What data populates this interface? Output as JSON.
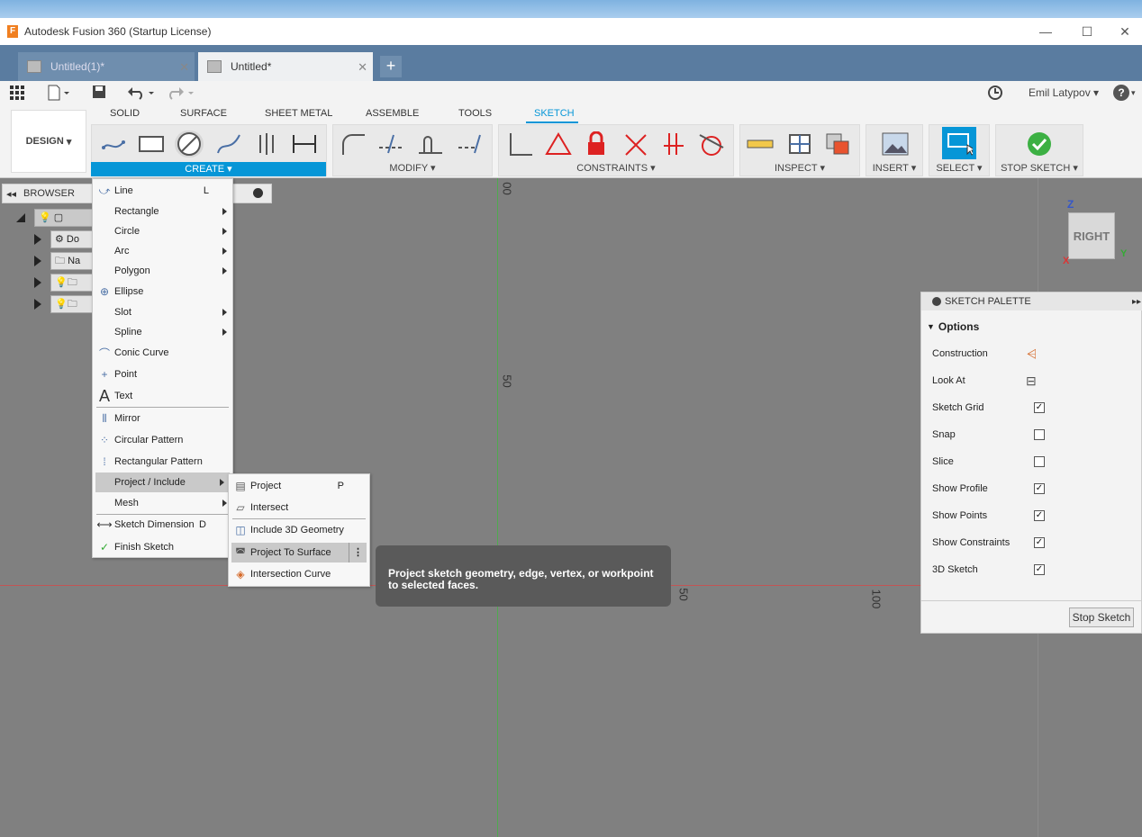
{
  "window": {
    "title": "Autodesk Fusion 360 (Startup License)",
    "app_icon": "F"
  },
  "tabs": [
    {
      "label": "Untitled(1)*"
    },
    {
      "label": "Untitled*"
    }
  ],
  "tab_add": "+",
  "qat": {
    "user": "Emil Latypov",
    "help": "?"
  },
  "ribbon": {
    "workspace": "DESIGN",
    "tabs": [
      "SOLID",
      "SURFACE",
      "SHEET METAL",
      "ASSEMBLE",
      "TOOLS",
      "SKETCH"
    ],
    "groups": {
      "create": "CREATE",
      "modify": "MODIFY",
      "constraints": "CONSTRAINTS",
      "inspect": "INSPECT",
      "insert": "INSERT",
      "select": "SELECT",
      "stop_sketch": "STOP SKETCH"
    }
  },
  "browser": {
    "label": "BROWSER",
    "items": [
      "Do",
      "Na"
    ]
  },
  "viewcube": {
    "face": "RIGHT",
    "axis_z": "Z",
    "axis_y": "Y",
    "axis_x": "X"
  },
  "canvas": {
    "ruler_top": "00",
    "ruler_50_v": "50",
    "ruler_50_h": "50",
    "ruler_100": "100"
  },
  "create_menu": {
    "items": [
      {
        "label": "Line",
        "shortcut": "L"
      },
      {
        "label": "Rectangle"
      },
      {
        "label": "Circle"
      },
      {
        "label": "Arc"
      },
      {
        "label": "Polygon"
      },
      {
        "label": "Ellipse"
      },
      {
        "label": "Slot"
      },
      {
        "label": "Spline"
      },
      {
        "label": "Conic Curve"
      },
      {
        "label": "Point"
      },
      {
        "label": "Text"
      },
      {
        "label": "Mirror"
      },
      {
        "label": "Circular Pattern"
      },
      {
        "label": "Rectangular Pattern"
      },
      {
        "label": "Project / Include"
      },
      {
        "label": "Mesh"
      },
      {
        "label": "Sketch Dimension",
        "shortcut": "D"
      },
      {
        "label": "Finish Sketch"
      }
    ]
  },
  "project_submenu": {
    "items": [
      {
        "label": "Project",
        "shortcut": "P"
      },
      {
        "label": "Intersect"
      },
      {
        "label": "Include 3D Geometry"
      },
      {
        "label": "Project To Surface"
      },
      {
        "label": "Intersection Curve"
      }
    ]
  },
  "tooltip": {
    "text": "Project sketch geometry, edge, vertex, or workpoint to selected faces."
  },
  "palette": {
    "title": "SKETCH PALETTE",
    "section": "Options",
    "rows": [
      {
        "label": "Construction"
      },
      {
        "label": "Look At"
      },
      {
        "label": "Sketch Grid",
        "checked": true
      },
      {
        "label": "Snap",
        "checked": false
      },
      {
        "label": "Slice",
        "checked": false
      },
      {
        "label": "Show Profile",
        "checked": true
      },
      {
        "label": "Show Points",
        "checked": true
      },
      {
        "label": "Show Constraints",
        "checked": true
      },
      {
        "label": "3D Sketch",
        "checked": true
      }
    ],
    "check_mark": "✓",
    "stop_button": "Stop Sketch"
  },
  "colors": {
    "accent": "#0696d7",
    "canvas": "#808080",
    "tooltip": "#5a5a5a"
  }
}
